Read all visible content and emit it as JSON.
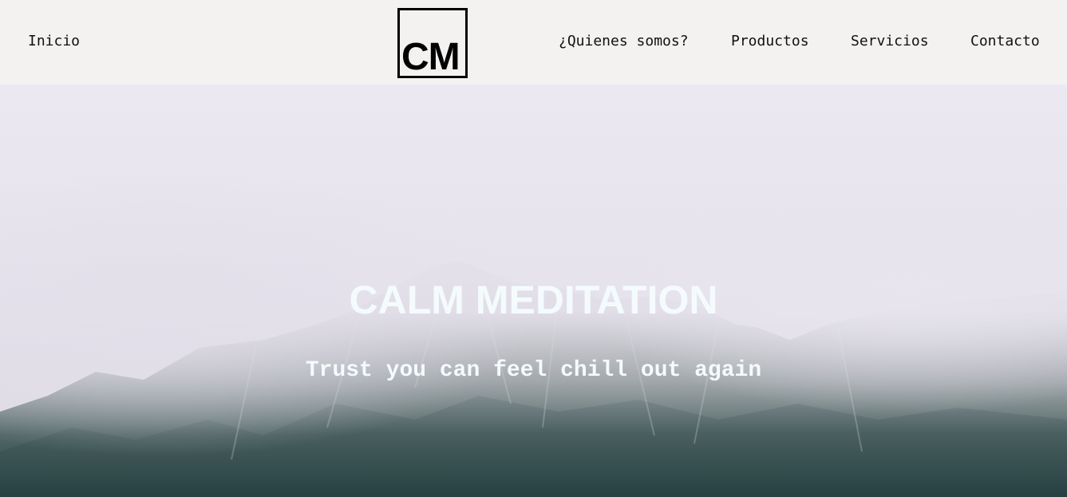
{
  "nav": {
    "items": [
      {
        "label": "Inicio"
      },
      {
        "label": "¿Quienes somos?"
      },
      {
        "label": "Productos"
      },
      {
        "label": "Servicios"
      },
      {
        "label": "Contacto"
      }
    ],
    "logo_text": "CM"
  },
  "hero": {
    "title": "CALM MEDITATION",
    "subtitle": "Trust you can feel chill out again"
  },
  "colors": {
    "nav_background": "#f3f2f0",
    "hero_text": "#f4fbfd",
    "logo_border": "#000000"
  }
}
